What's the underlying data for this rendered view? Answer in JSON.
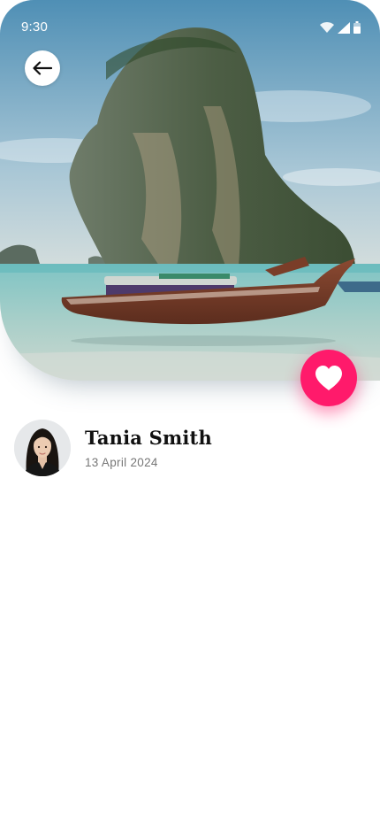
{
  "status_bar": {
    "time": "9:30",
    "icons": [
      "wifi-icon",
      "signal-icon",
      "battery-icon"
    ]
  },
  "navigation": {
    "back_icon": "arrow-left-icon"
  },
  "hero": {
    "image": "longtail-boat-limestone-island-photo"
  },
  "favorite": {
    "icon": "heart-icon",
    "color": "#ff1a6b"
  },
  "author": {
    "name": "Tania Smith",
    "date": "13 April 2024",
    "avatar": "user-avatar-photo"
  }
}
